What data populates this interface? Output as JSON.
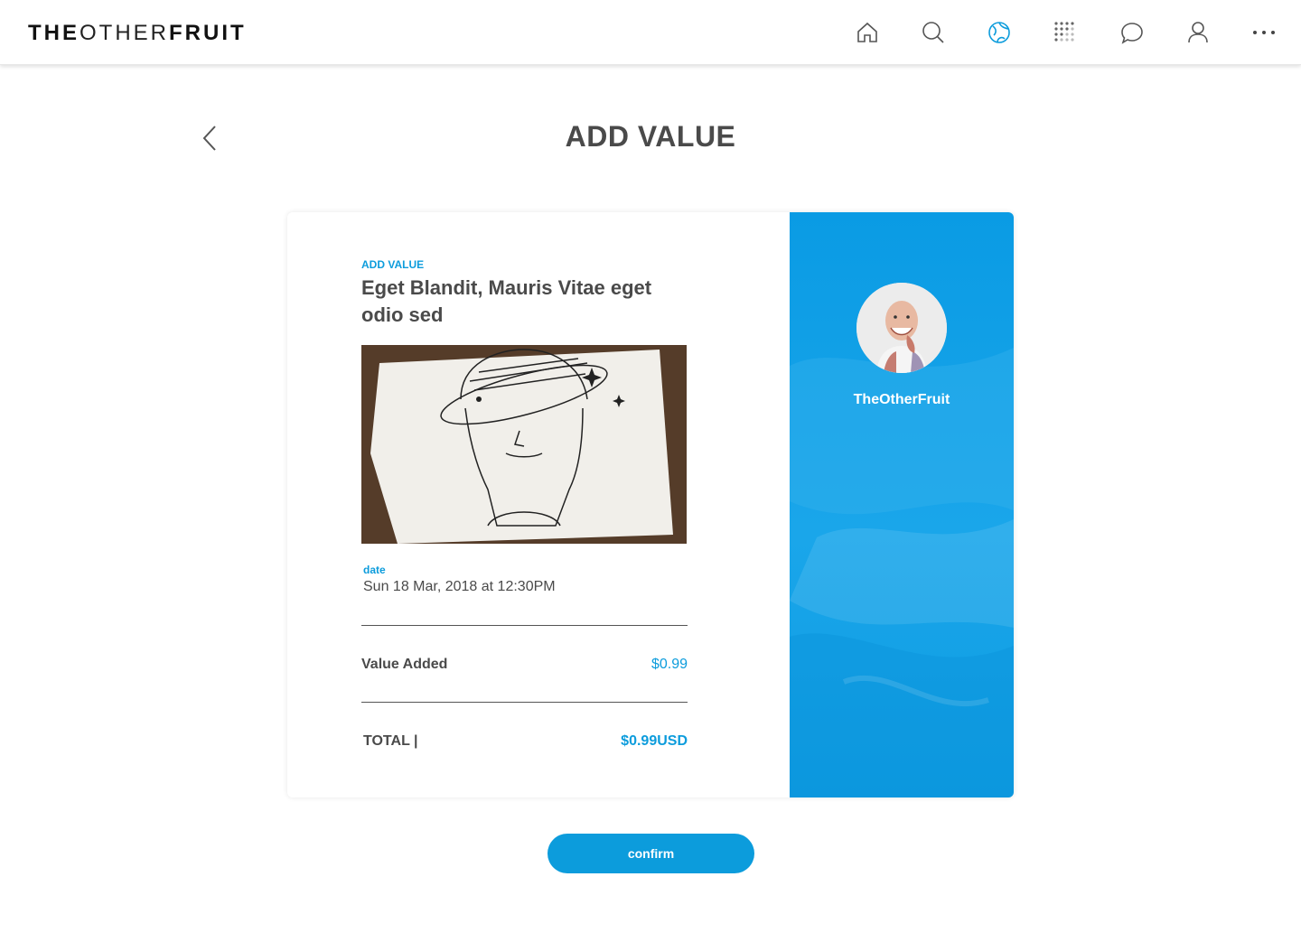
{
  "header": {
    "logo": {
      "part1": "THE",
      "part2": "OTHER",
      "part3": "FRUIT"
    },
    "nav": [
      {
        "name": "home-icon"
      },
      {
        "name": "search-icon"
      },
      {
        "name": "globe-icon",
        "active": true
      },
      {
        "name": "grid-dots-icon"
      },
      {
        "name": "chat-icon"
      },
      {
        "name": "user-icon"
      },
      {
        "name": "more-icon"
      }
    ],
    "accent_color": "#0c9cdc"
  },
  "page": {
    "title": "ADD VALUE",
    "back_icon": "chevron-left-icon"
  },
  "card": {
    "eyebrow": "ADD VALUE",
    "item_title": "Eget Blandit, Mauris Vitae eget odio sed",
    "date_label": "date",
    "date_value": "Sun 18 Mar, 2018 at 12:30PM",
    "value_added_label": "Value Added",
    "value_added": "$0.99",
    "total_label": "TOTAL |",
    "total_value": "$0.99USD"
  },
  "profile": {
    "username": "TheOtherFruit",
    "panel_color": "#0a9be4"
  },
  "actions": {
    "confirm_label": "confirm"
  }
}
